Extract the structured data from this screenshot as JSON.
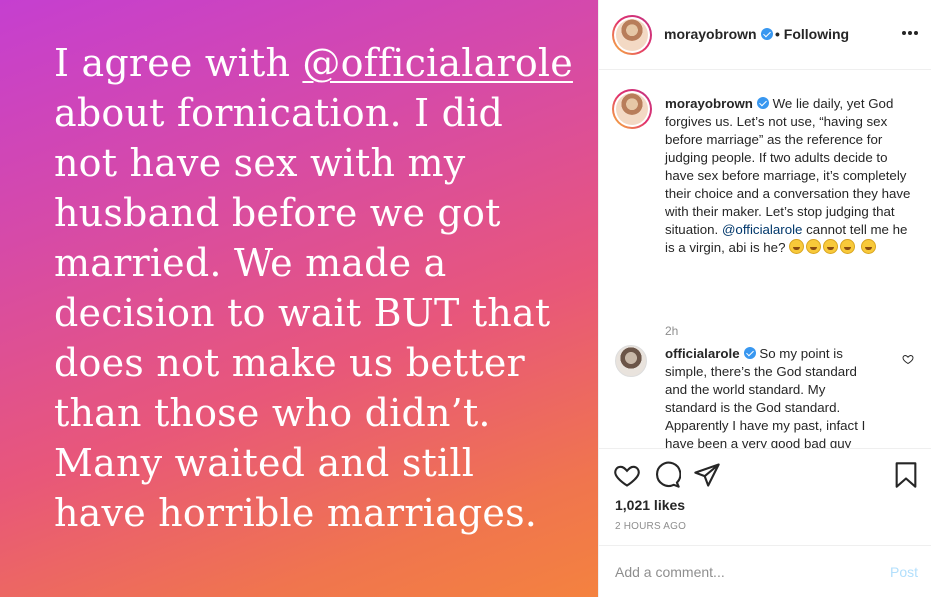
{
  "story": {
    "line_before_mention": "I agree with ",
    "mention": "@officialarole",
    "text_after": "about fornication. I did not have sex with my husband before we got married. We made a decision to wait BUT that does not make us better than those who didn’t. Many waited and still have horrible marriages."
  },
  "header": {
    "username": "morayobrown",
    "follow_status": "• Following",
    "avatar_icon": "profile-photo"
  },
  "caption": {
    "username": "morayobrown",
    "text_before_mention": "We lie daily, yet God forgives us. Let’s not use, “having sex before marriage” as the reference for judging people. If two adults decide to have sex before marriage, it’s completely their choice and a conversation they have with their maker. Let’s stop judging that situation.",
    "mention": "@officialarole",
    "text_after_mention": "cannot tell me he is a virgin, abi is he?",
    "time": "2h"
  },
  "reply": {
    "username": "officialarole",
    "text": "So my point is simple, there’s the God standard and the world standard. My standard is the God standard. Apparently I have my past, infact I have been a very good bad guy"
  },
  "actions": {
    "likes": "1,021 likes",
    "posted": "2 HOURS AGO",
    "comment_placeholder": "Add a comment...",
    "post_label": "Post"
  },
  "colors": {
    "verified": "#3897f0",
    "mention": "#00376b",
    "post_disabled": "#b2dffc",
    "muted": "#8e8e8e"
  }
}
